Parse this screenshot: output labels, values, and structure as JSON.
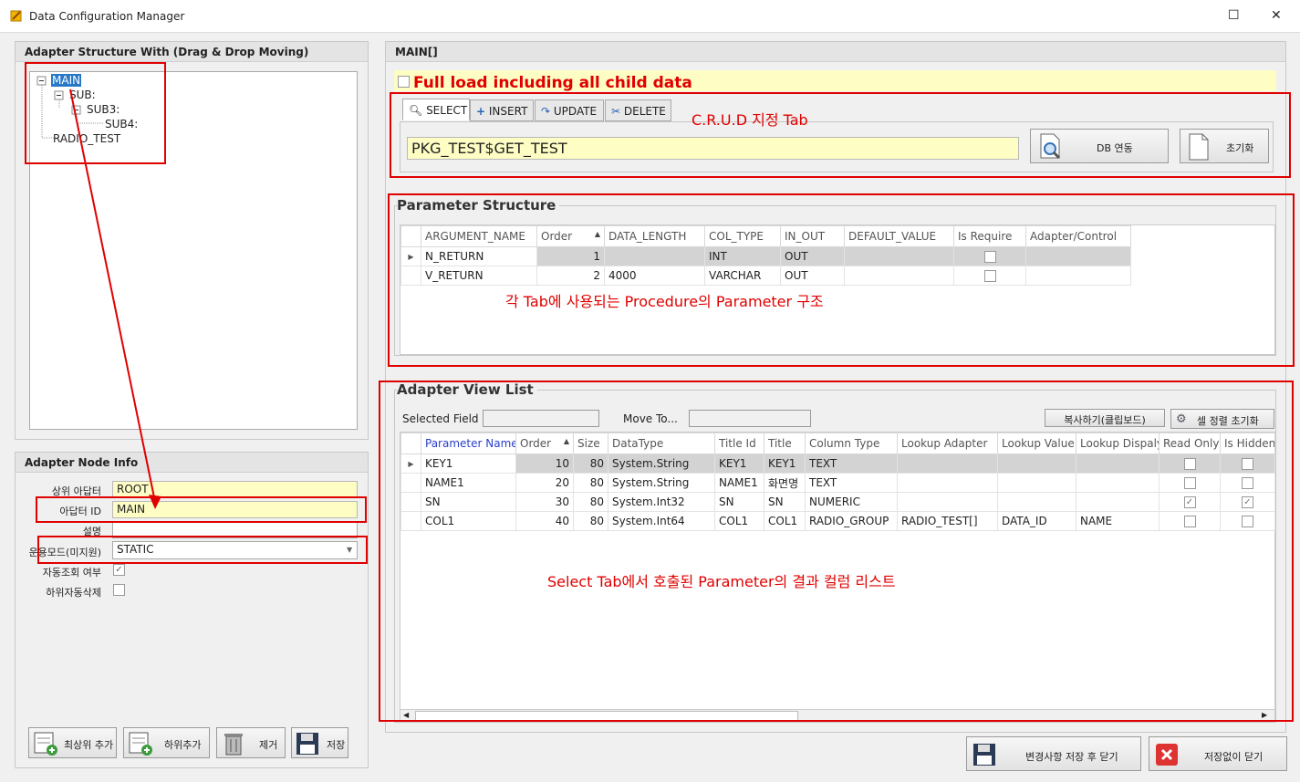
{
  "window": {
    "title": "Data Configuration Manager",
    "maximize": "☐",
    "close": "✕"
  },
  "left": {
    "tree_title": "Adapter Structure With (Drag & Drop Moving)",
    "tree": {
      "main": "MAIN",
      "sub": "SUB:",
      "sub3": "SUB3:",
      "sub4": "SUB4:",
      "radio": "RADIO_TEST"
    },
    "node_info_title": "Adapter Node Info",
    "fields": {
      "parent_label": "상위 아답터",
      "parent_value": "ROOT",
      "id_label": "아답터 ID",
      "id_value": "MAIN",
      "desc_label": "설명",
      "desc_value": "",
      "mode_label": "운용모드(미지원)",
      "mode_value": "STATIC",
      "auto_query_label": "자동조회 여부",
      "child_delete_label": "하위자동삭제"
    },
    "buttons": {
      "add_top": "최상위 추가",
      "add_child": "하위추가",
      "remove": "제거",
      "save": "저장"
    }
  },
  "main": {
    "title": "MAIN[]",
    "full_load": "Full load including all child data",
    "tabs": {
      "select": "SELECT",
      "insert": "INSERT",
      "update": "UPDATE",
      "delete": "DELETE"
    },
    "procedure": "PKG_TEST$GET_TEST",
    "db_button": "DB 연동",
    "reset_button": "초기화"
  },
  "param": {
    "title": "Parameter Structure",
    "columns": [
      "ARGUMENT_NAME",
      "Order",
      "DATA_LENGTH",
      "COL_TYPE",
      "IN_OUT",
      "DEFAULT_VALUE",
      "Is Require",
      "Adapter/Control"
    ],
    "rows": [
      {
        "name": "N_RETURN",
        "order": "1",
        "length": "",
        "type": "INT",
        "inout": "OUT",
        "default": "",
        "adapter": ""
      },
      {
        "name": "V_RETURN",
        "order": "2",
        "length": "4000",
        "type": "VARCHAR",
        "inout": "OUT",
        "default": "",
        "adapter": ""
      }
    ]
  },
  "view": {
    "title": "Adapter View List",
    "selected_field_label": "Selected Field",
    "move_to_label": "Move To...",
    "copy_button": "복사하기(클립보드)",
    "reset_order_button": "셀 정렬 초기화",
    "columns": [
      "Parameter Name",
      "Order",
      "Size",
      "DataType",
      "Title Id",
      "Title",
      "Column Type",
      "Lookup Adapter",
      "Lookup Value",
      "Lookup Dispaly",
      "Read Only",
      "Is Hidden"
    ],
    "rows": [
      {
        "name": "KEY1",
        "order": "10",
        "size": "80",
        "dtype": "System.String",
        "tid": "KEY1",
        "title": "KEY1",
        "ctype": "TEXT",
        "ladapter": "",
        "lvalue": "",
        "ldisplay": "",
        "ro": false,
        "hidden": false
      },
      {
        "name": "NAME1",
        "order": "20",
        "size": "80",
        "dtype": "System.String",
        "tid": "NAME1",
        "title": "화면명",
        "ctype": "TEXT",
        "ladapter": "",
        "lvalue": "",
        "ldisplay": "",
        "ro": false,
        "hidden": false
      },
      {
        "name": "SN",
        "order": "30",
        "size": "80",
        "dtype": "System.Int32",
        "tid": "SN",
        "title": "SN",
        "ctype": "NUMERIC",
        "ladapter": "",
        "lvalue": "",
        "ldisplay": "",
        "ro": true,
        "hidden": true
      },
      {
        "name": "COL1",
        "order": "40",
        "size": "80",
        "dtype": "System.Int64",
        "tid": "COL1",
        "title": "COL1",
        "ctype": "RADIO_GROUP",
        "ladapter": "RADIO_TEST[]",
        "lvalue": "DATA_ID",
        "ldisplay": "NAME",
        "ro": false,
        "hidden": false
      }
    ]
  },
  "footer": {
    "save_close": "변경사항 저장 후 닫기",
    "close_nosave": "저장없이 닫기"
  },
  "annotations": {
    "crud": "C.R.U.D 지정 Tab",
    "param": "각 Tab에 사용되는  Procedure의 Parameter 구조",
    "result": "Select Tab에서 호출된 Parameter의 결과 컬럼 리스트"
  }
}
